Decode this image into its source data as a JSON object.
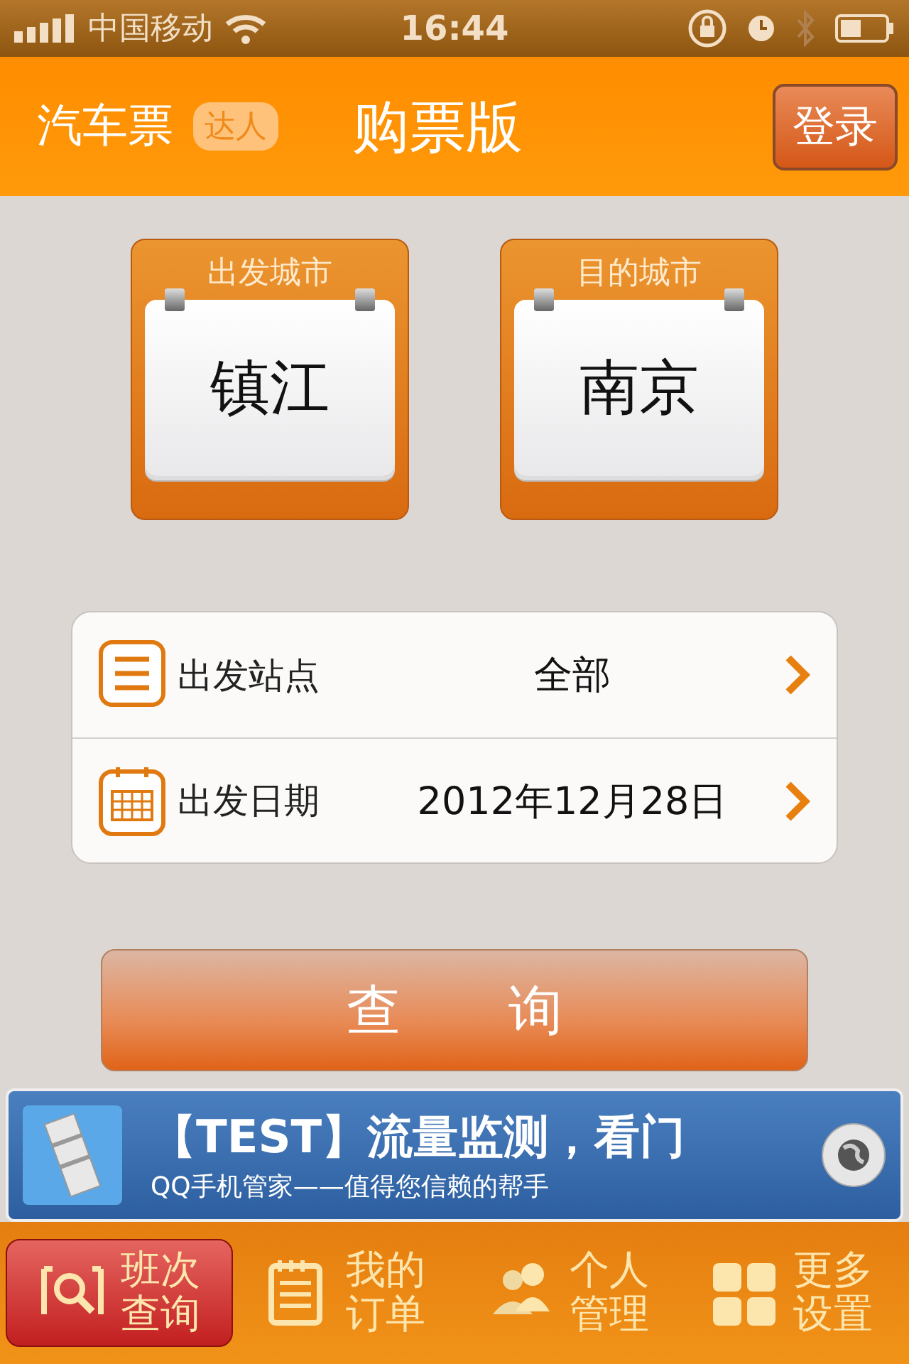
{
  "status_bar": {
    "carrier": "中国移动",
    "time": "16:44"
  },
  "header": {
    "title": "汽车票",
    "badge": "达人",
    "subtitle": "购票版",
    "login_button": "登录"
  },
  "cities": [
    {
      "label": "出发城市",
      "value": "镇江"
    },
    {
      "label": "目的城市",
      "value": "南京"
    }
  ],
  "options": [
    {
      "kind": "list",
      "label": "出发站点",
      "value": "全部"
    },
    {
      "kind": "calendar",
      "label": "出发日期",
      "value": "2012年12月28日"
    }
  ],
  "search_button": "查　　询",
  "ad": {
    "title": "【TEST】流量监测，看门",
    "subtitle": "QQ手机管家——值得您信赖的帮手"
  },
  "tabs": [
    {
      "kind": "search",
      "label": "班次查询",
      "selected": true
    },
    {
      "kind": "orders",
      "label": "我的订单",
      "selected": false
    },
    {
      "kind": "people",
      "label": "个人管理",
      "selected": false
    },
    {
      "kind": "grid",
      "label": "更多设置",
      "selected": false
    }
  ]
}
